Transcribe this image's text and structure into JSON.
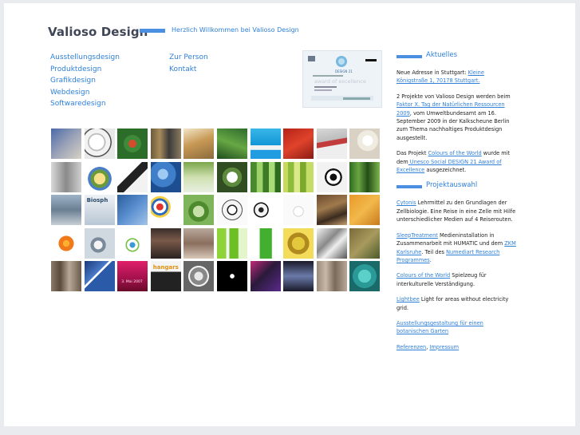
{
  "header": {
    "brand": "Valioso Design",
    "welcome": "Herzlich Willkommen bei Valioso Design"
  },
  "nav": {
    "col1": [
      "Ausstellungsdesign",
      "Produktdesign",
      "Grafikdesign",
      "Webdesign",
      "Softwaredesign"
    ],
    "col2": [
      "Zur Person",
      "Kontakt"
    ]
  },
  "award": {
    "line1": "award of excellence",
    "brand": "DESIGN 21"
  },
  "colors": {
    "accent": "#4a8fe2",
    "link": "#2f80d9",
    "brand_text": "#3f4656"
  },
  "aktuelles": {
    "title": "Aktuelles",
    "p1_text": "Neue Adresse in Stuttgart: ",
    "p1_link": "Kleine Königstraße 1, 70178 Stuttgart.",
    "p2_text1": "2 Projekte von Valioso Design werden beim ",
    "p2_link": "Faktor X. Tag der Natürlichen Ressourcen 2009",
    "p2_text2": ", vom Umweltbundesamt am 16. September 2009 in der Kalkscheune Berlin zum Thema nachhaltiges Produktdesign ausgestellt.",
    "p3_text1": "Das Projekt ",
    "p3_link1": "Colours of the World",
    "p3_text2": " wurde mit dem",
    "p3_link2": " Unesco Social DESIGN 21 Award of Excellence",
    "p3_text3": " ausgezeichnet."
  },
  "projekte": {
    "title": "Projektauswahl",
    "items": [
      {
        "link": "Cytonis",
        "text": " Lehrmittel zu den Grundlagen der Zellbiologie. Eine Reise in eine Zelle mit Hilfe unterschiedlicher Medien auf 4 Reiserouten."
      },
      {
        "link": "SleepTreatment",
        "text": " Medieninstallation in Zusammenarbeit mit HUMATIC und dem ",
        "link2": "ZKM Karlsruhe",
        "text2": ". Teil des ",
        "link3": "Numediart Research Programmes",
        "text3": "."
      },
      {
        "link": "Colours of the World",
        "text": " Spielzeug für interkulturelle Verständigung."
      },
      {
        "link": "Lightbee",
        "text": " Light for areas without electricity grid."
      },
      {
        "link": "Ausstellungsgestaltung für einen botanischen Garten",
        "text": ""
      }
    ],
    "footer_link1": "Referenzen",
    "footer_sep": ", ",
    "footer_link2": "Impressum"
  },
  "thumbnails": {
    "count": 50,
    "labels": {
      "t22": "Biosph",
      "t43": "hangars",
      "t43b": "3. Mai 2007"
    }
  }
}
